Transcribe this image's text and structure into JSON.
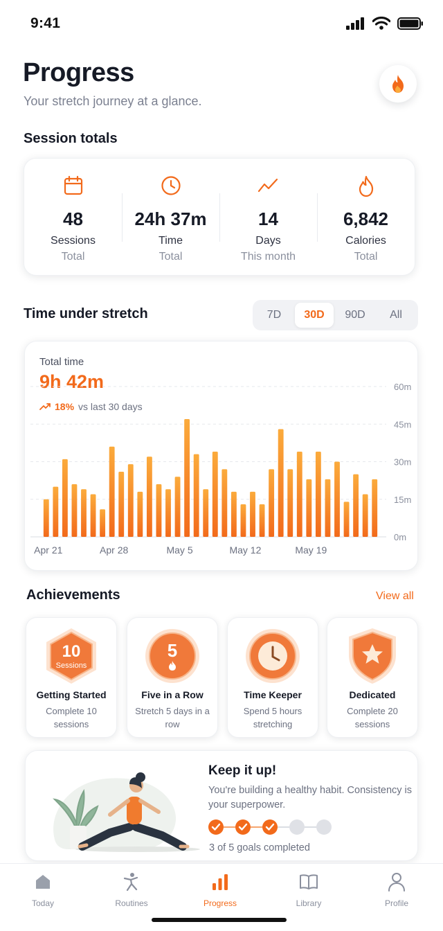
{
  "status": {
    "time": "9:41"
  },
  "header": {
    "title": "Progress",
    "subtitle": "Your stretch journey at a glance."
  },
  "totals": {
    "heading": "Session totals",
    "items": [
      {
        "icon": "calendar-icon",
        "value": "48",
        "label": "Sessions",
        "sub": "Total"
      },
      {
        "icon": "clock-icon",
        "value": "24h 37m",
        "label": "Time",
        "sub": "Total"
      },
      {
        "icon": "trend-line-icon",
        "value": "14",
        "label": "Days",
        "sub": "This month"
      },
      {
        "icon": "flame-icon",
        "value": "6,842",
        "label": "Calories",
        "sub": "Total"
      }
    ]
  },
  "time_section": {
    "heading": "Time under stretch",
    "ranges": [
      "7D",
      "30D",
      "90D",
      "All"
    ],
    "selected_range": "30D"
  },
  "chart_data": {
    "type": "bar",
    "caption": "Total time",
    "total": "9h 42m",
    "change": "18%",
    "change_text": "vs last 30 days",
    "y_unit": "minutes",
    "ylim": [
      0,
      60
    ],
    "yticks": [
      0,
      15,
      30,
      45,
      60
    ],
    "ytick_labels": [
      "0m",
      "15m",
      "30m",
      "45m",
      "60m"
    ],
    "xtick_labels": [
      "Apr 21",
      "Apr 28",
      "May 5",
      "May 12",
      "May 19"
    ],
    "xtick_index": [
      0,
      7,
      14,
      21,
      28
    ],
    "grid": true,
    "values": [
      15,
      20,
      31,
      21,
      19,
      17,
      11,
      36,
      26,
      29,
      18,
      32,
      21,
      19,
      24,
      47,
      33,
      19,
      34,
      27,
      18,
      13,
      18,
      13,
      27,
      43,
      27,
      34,
      23,
      34,
      23,
      30,
      14,
      25,
      17,
      23
    ]
  },
  "achievements": {
    "heading": "Achievements",
    "view_all": "View all",
    "items": [
      {
        "badge_top": "10",
        "badge_bottom": "Sessions",
        "name": "Getting Started",
        "desc": "Complete 10 sessions"
      },
      {
        "badge_top": "5",
        "badge_bottom": "",
        "name": "Five in a Row",
        "desc": "Stretch 5 days in a row"
      },
      {
        "badge_top": "",
        "badge_bottom": "",
        "name": "Time Keeper",
        "desc": "Spend 5 hours stretching"
      },
      {
        "badge_top": "",
        "badge_bottom": "",
        "name": "Dedicated",
        "desc": "Complete 20 sessions"
      }
    ]
  },
  "motivation": {
    "title": "Keep it up!",
    "desc": "You're building a healthy habit. Consistency is your superpower.",
    "goals_done": 3,
    "goals_total": 5,
    "goals_text": "3 of 5 goals completed"
  },
  "tabs": [
    {
      "label": "Today",
      "icon": "home-icon"
    },
    {
      "label": "Routines",
      "icon": "person-stretch-icon"
    },
    {
      "label": "Progress",
      "icon": "bar-chart-icon",
      "active": true
    },
    {
      "label": "Library",
      "icon": "book-icon"
    },
    {
      "label": "Profile",
      "icon": "user-icon"
    }
  ],
  "colors": {
    "accent": "#f26a1b",
    "accent_light": "#fbab3c"
  }
}
